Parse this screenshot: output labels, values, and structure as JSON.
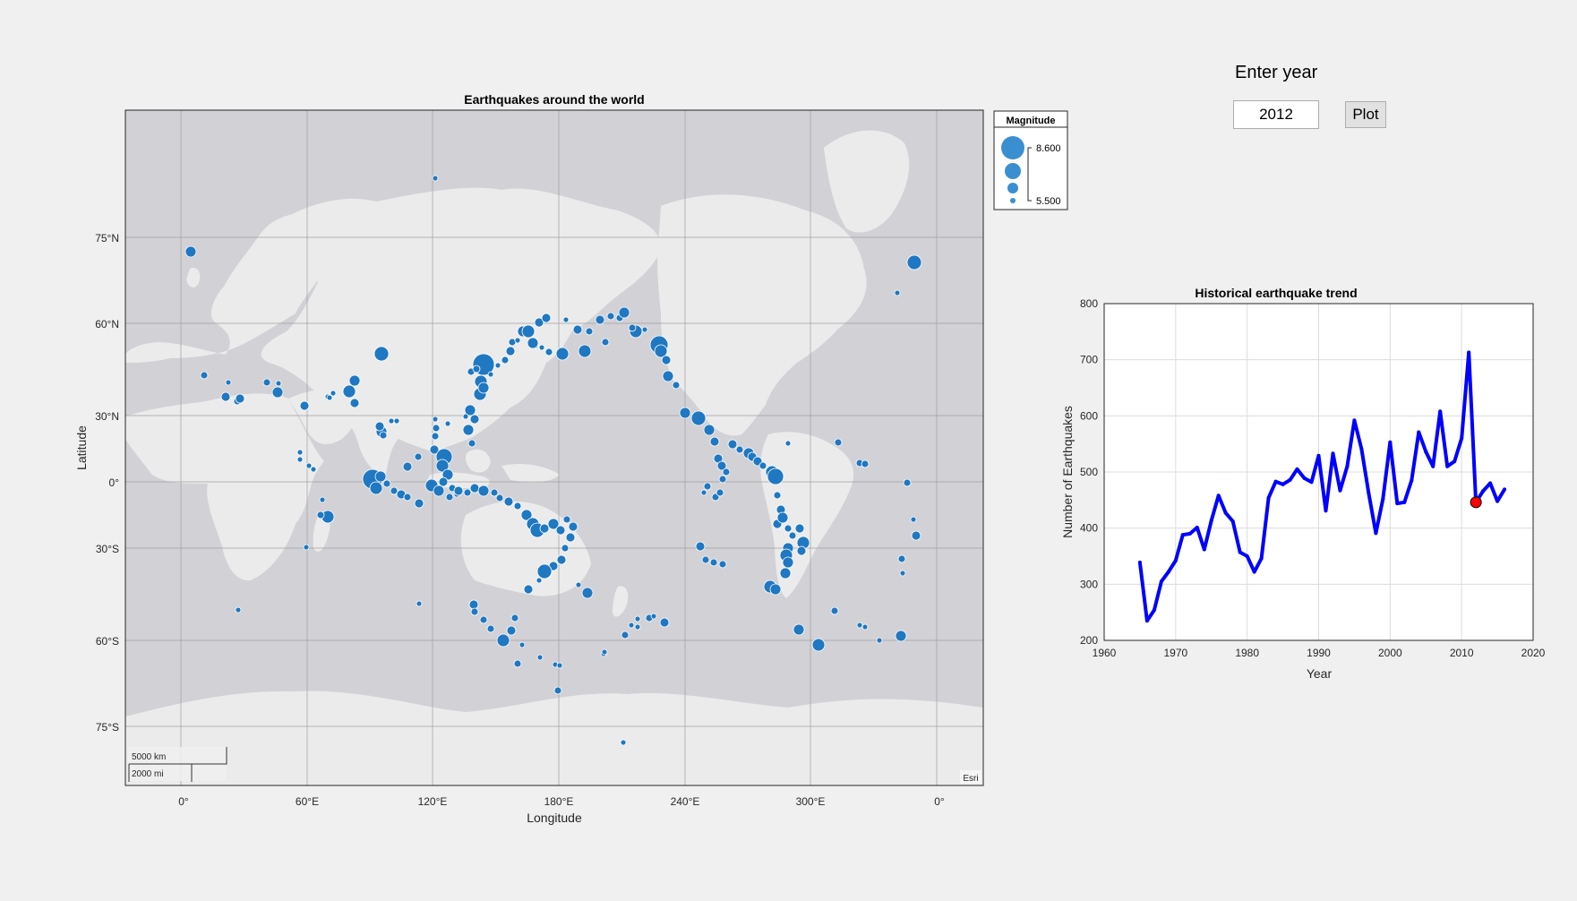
{
  "controls": {
    "prompt_label": "Enter year",
    "year_value": "2012",
    "plot_button_label": "Plot"
  },
  "map": {
    "title": "Earthquakes around the world",
    "xlabel": "Longitude",
    "ylabel": "Latitude",
    "x_ticks": [
      "0°",
      "60°E",
      "120°E",
      "180°E",
      "240°E",
      "300°E",
      "0°"
    ],
    "y_ticks": [
      "75°N",
      "60°N",
      "30°N",
      "0°",
      "30°S",
      "60°S",
      "75°S"
    ],
    "legend": {
      "title": "Magnitude",
      "max_label": "8.600",
      "min_label": "5.500"
    },
    "scalebar": {
      "km_label": "5000 km",
      "mi_label": "2000 mi"
    },
    "attribution": "Esri",
    "colors": {
      "marker": "#1f78c1",
      "land": "#ebebeb",
      "ocean": "#d1d1d6",
      "grid": "#a0a0a0"
    }
  },
  "chart_data": {
    "type": "line",
    "title": "Historical earthquake trend",
    "xlabel": "Year",
    "ylabel": "Number of Earthquakes",
    "xlim": [
      1960,
      2020
    ],
    "ylim": [
      200,
      800
    ],
    "x_ticks": [
      "1960",
      "1970",
      "1980",
      "1990",
      "2000",
      "2010",
      "2020"
    ],
    "y_ticks": [
      "200",
      "300",
      "400",
      "500",
      "600",
      "700",
      "800"
    ],
    "grid": true,
    "line_color": "#0000ff",
    "highlight_color": "#ff0000",
    "x": [
      1965,
      1966,
      1967,
      1968,
      1969,
      1970,
      1971,
      1972,
      1973,
      1974,
      1975,
      1976,
      1977,
      1978,
      1979,
      1980,
      1981,
      1982,
      1983,
      1984,
      1985,
      1986,
      1987,
      1988,
      1989,
      1990,
      1991,
      1992,
      1993,
      1994,
      1995,
      1996,
      1997,
      1998,
      1999,
      2000,
      2001,
      2002,
      2003,
      2004,
      2005,
      2006,
      2007,
      2008,
      2009,
      2010,
      2011,
      2012,
      2013,
      2014,
      2015,
      2016
    ],
    "y": [
      339,
      235,
      254,
      305,
      322,
      342,
      388,
      390,
      401,
      362,
      414,
      458,
      427,
      412,
      357,
      350,
      322,
      346,
      454,
      483,
      478,
      486,
      505,
      489,
      482,
      529,
      431,
      533,
      467,
      510,
      592,
      541,
      462,
      391,
      452,
      553,
      444,
      446,
      485,
      571,
      536,
      510,
      608,
      510,
      519,
      560,
      713,
      446,
      466,
      480,
      448,
      469
    ],
    "highlight": {
      "x": 2012,
      "y": 446
    }
  }
}
